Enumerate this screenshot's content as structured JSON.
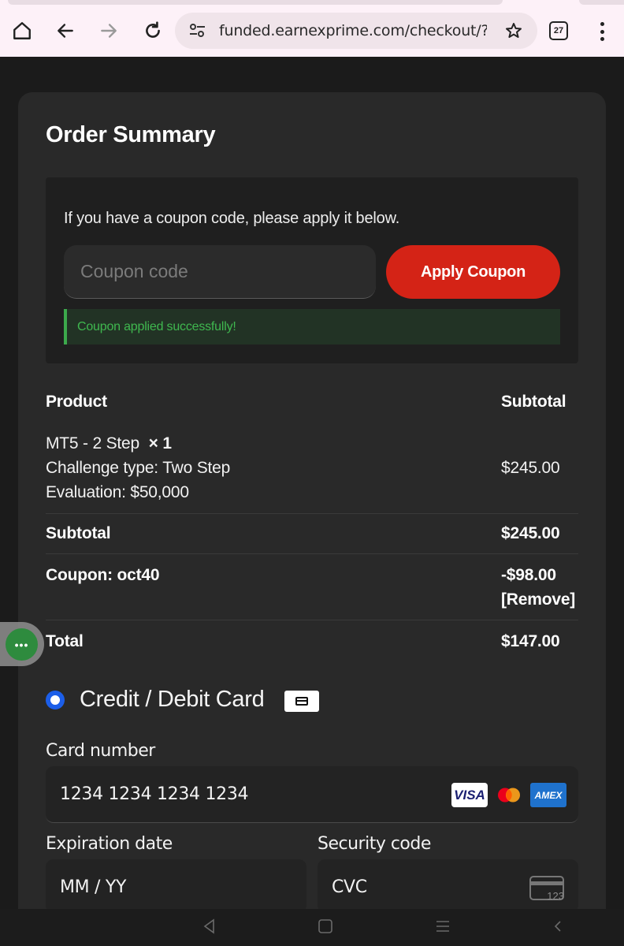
{
  "browser": {
    "url": "funded.earnexprime.com/checkout/?acc",
    "tab_count": "27",
    "icons": [
      "home-icon",
      "back-icon",
      "forward-icon",
      "reload-icon",
      "site-settings-icon",
      "bookmark-star-icon",
      "tab-switcher-icon",
      "menu-kebab-icon"
    ]
  },
  "order_summary": {
    "title": "Order Summary",
    "coupon": {
      "hint": "If you have a coupon code, please apply it below.",
      "placeholder": "Coupon code",
      "apply_label": "Apply Coupon",
      "success_message": "Coupon applied successfully!"
    },
    "table": {
      "header_product": "Product",
      "header_subtotal": "Subtotal",
      "item": {
        "name": "MT5 - 2 Step",
        "quantity": "× 1",
        "challenge_type": "Challenge type: Two Step",
        "evaluation": "Evaluation: $50,000",
        "price": "$245.00"
      },
      "subtotal_label": "Subtotal",
      "subtotal_value": "$245.00",
      "coupon_label": "Coupon: oct40",
      "coupon_value": "-$98.00",
      "remove_label": "[Remove]",
      "total_label": "Total",
      "total_value": "$147.00"
    }
  },
  "payment": {
    "method_label": "Credit / Debit Card",
    "card_number_label": "Card number",
    "card_number_value": "1234 1234 1234 1234",
    "expiry_label": "Expiration date",
    "expiry_value": "MM / YY",
    "security_label": "Security code",
    "security_value": "CVC",
    "brands": {
      "visa": "VISA",
      "amex": "AMEX"
    },
    "cvc_icon_text": "123"
  },
  "side_bubble": {
    "glyph": "•••"
  },
  "colors": {
    "accent_red": "#d42316",
    "success_green": "#3fb84f",
    "radio_blue": "#1c5ee8",
    "panel": "#292929",
    "background": "#1b1b1b"
  }
}
